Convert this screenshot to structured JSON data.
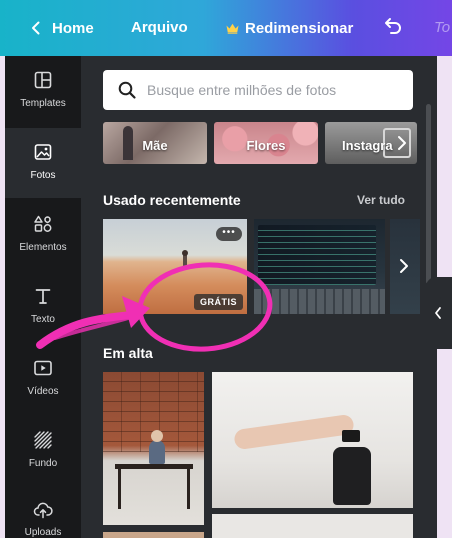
{
  "topbar": {
    "home_label": "Home",
    "file_label": "Arquivo",
    "resize_label": "Redimensionar",
    "faded_text": "To"
  },
  "sidebar": {
    "items": [
      {
        "label": "Templates",
        "icon": "layout-icon"
      },
      {
        "label": "Fotos",
        "icon": "image-icon",
        "active": true
      },
      {
        "label": "Elementos",
        "icon": "shapes-icon"
      },
      {
        "label": "Texto",
        "icon": "text-icon"
      },
      {
        "label": "Vídeos",
        "icon": "video-icon"
      },
      {
        "label": "Fundo",
        "icon": "pattern-icon"
      },
      {
        "label": "Uploads",
        "icon": "cloud-upload-icon"
      }
    ]
  },
  "panel": {
    "search_placeholder": "Busque entre milhões de fotos",
    "categories": [
      {
        "label": "Mãe"
      },
      {
        "label": "Flores"
      },
      {
        "label": "Instagra"
      }
    ],
    "recent": {
      "title": "Usado recentemente",
      "see_all": "Ver tudo",
      "badge": "GRÁTIS",
      "more_icon": "•••"
    },
    "trending": {
      "title": "Em alta"
    }
  },
  "colors": {
    "topbar_start": "#18b3c9",
    "topbar_end": "#7446e6",
    "rail_bg": "#18191b",
    "panel_bg": "#292c30",
    "annotation": "#f02fb4"
  }
}
